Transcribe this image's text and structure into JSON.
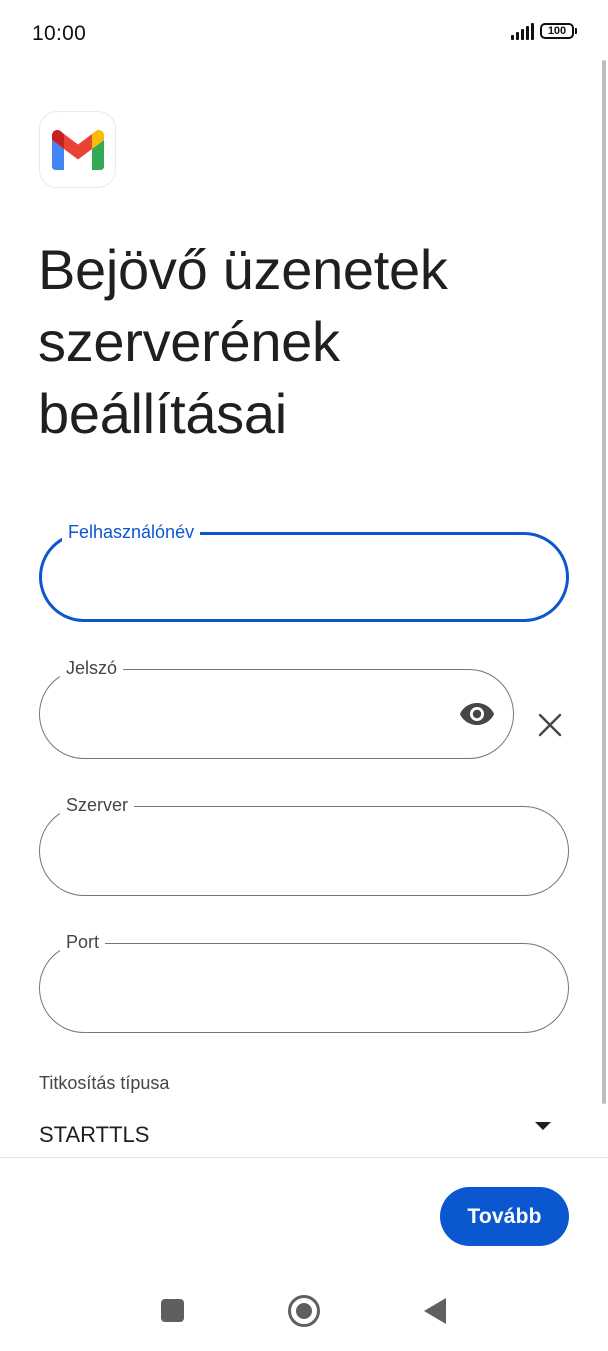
{
  "status_bar": {
    "time": "10:00",
    "battery": "100",
    "icons": [
      "signal-icon",
      "battery-icon"
    ]
  },
  "logo": {
    "icon": "gmail-icon",
    "colors": {
      "blue": "#4285F4",
      "red": "#EA4335",
      "yellow": "#FBBC04",
      "green": "#34A853",
      "dark_red": "#C5221F"
    }
  },
  "page": {
    "title": "Bejövő üzenetek szerverének beállításai"
  },
  "form": {
    "username": {
      "label": "Felhasználónév",
      "value": "",
      "focused": true
    },
    "password": {
      "label": "Jelszó",
      "value": "",
      "toggle_icon": "eye-icon",
      "clear_icon": "close-icon"
    },
    "server": {
      "label": "Szerver",
      "value": ""
    },
    "port": {
      "label": "Port",
      "value": ""
    },
    "encryption": {
      "label": "Titkosítás típusa",
      "selected": "STARTTLS",
      "icon": "dropdown-arrow-icon"
    }
  },
  "footer": {
    "next_label": "Tovább"
  },
  "colors": {
    "accent": "#0B57D0",
    "outline": "#747775",
    "text": "#1F1F1F"
  },
  "nav_bar": {
    "icons": [
      "recents-icon",
      "home-icon",
      "back-icon"
    ]
  }
}
